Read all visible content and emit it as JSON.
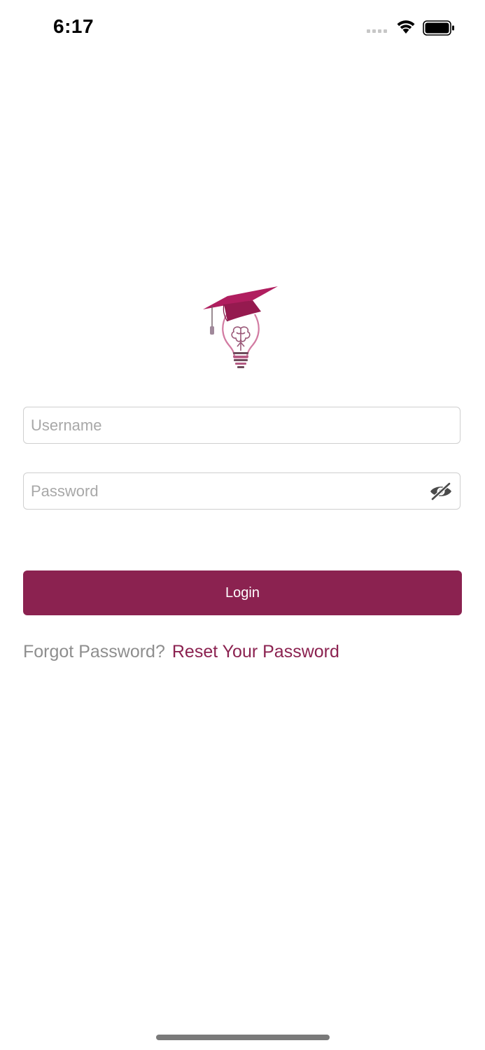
{
  "status_bar": {
    "time": "6:17",
    "signal_icon": "signal-dots-icon",
    "wifi_icon": "wifi-icon",
    "battery_icon": "battery-icon"
  },
  "logo": {
    "icon": "graduation-cap-lightbulb-logo",
    "accent_color": "#b01e5f"
  },
  "form": {
    "username": {
      "placeholder": "Username",
      "value": ""
    },
    "password": {
      "placeholder": "Password",
      "value": "",
      "toggle_icon": "eye-slash-icon"
    },
    "login_label": "Login",
    "login_color": "#8b2250"
  },
  "forgot": {
    "label": "Forgot Password?",
    "link": "Reset Your Password"
  }
}
